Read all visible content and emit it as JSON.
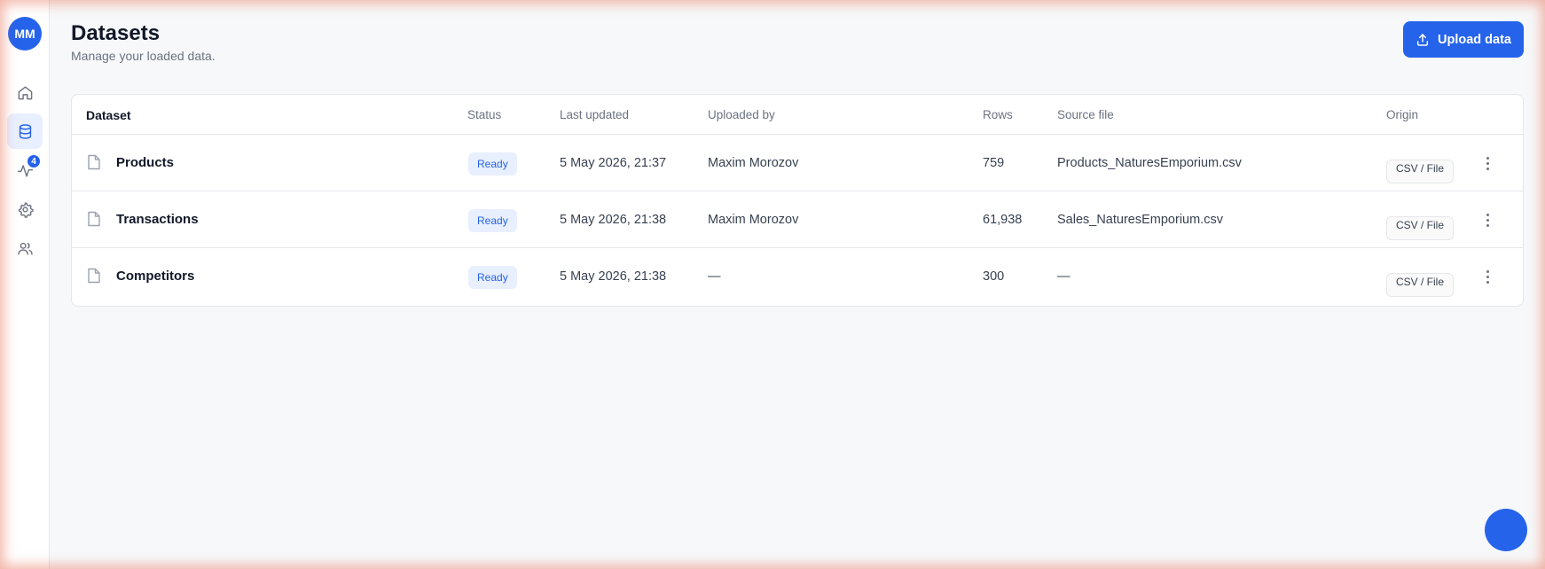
{
  "user": {
    "initials": "MM"
  },
  "nav": {
    "items": [
      {
        "name": "home",
        "icon": "home-icon"
      },
      {
        "name": "datasets",
        "icon": "database-icon",
        "active": true
      },
      {
        "name": "activity",
        "icon": "activity-icon",
        "badge": "4"
      },
      {
        "name": "settings",
        "icon": "gear-icon"
      },
      {
        "name": "users",
        "icon": "users-icon"
      }
    ]
  },
  "header": {
    "title": "Datasets",
    "subtitle": "Manage your loaded data.",
    "upload_label": "Upload data"
  },
  "table": {
    "columns": [
      "Dataset",
      "Status",
      "Last updated",
      "Uploaded by",
      "Rows",
      "Source file",
      "Origin"
    ],
    "rows": [
      {
        "name": "Products",
        "status": "Ready",
        "updated": "5 May 2026, 21:37",
        "uploader": "Maxim Morozov",
        "rows": "759",
        "source": "Products_NaturesEmporium.csv",
        "origin": "CSV / File"
      },
      {
        "name": "Transactions",
        "status": "Ready",
        "updated": "5 May 2026, 21:38",
        "uploader": "Maxim Morozov",
        "rows": "61,938",
        "source": "Sales_NaturesEmporium.csv",
        "origin": "CSV / File"
      },
      {
        "name": "Competitors",
        "status": "Ready",
        "updated": "5 May 2026, 21:38",
        "uploader": "—",
        "rows": "300",
        "source": "—",
        "origin": "CSV / File"
      }
    ]
  },
  "colors": {
    "accent": "#2563eb",
    "badge_bg": "#e8efff",
    "frame_glow": "#e8785f"
  }
}
